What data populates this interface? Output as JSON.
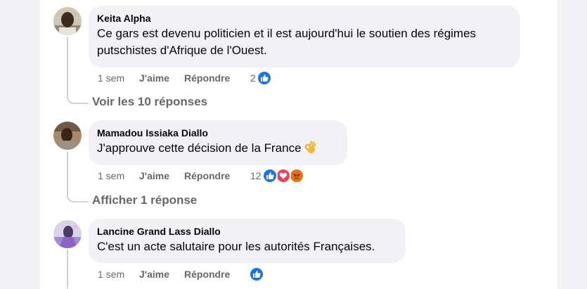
{
  "comments": [
    {
      "author": "Keita Alpha",
      "text": "Ce gars est devenu politicien et il est aujourd'hui le soutien des régimes putschistes d'Afrique de l'Ouest.",
      "time": "1 sem",
      "like_label": "J'aime",
      "reply_label": "Répondre",
      "reaction_count": "2",
      "reactions": [
        "like-icon"
      ]
    },
    {
      "author": "Mamadou Issiaka Diallo",
      "text": "J'approuve cette décision de la France",
      "emoji": "ok-hand-icon",
      "time": "1 sem",
      "like_label": "J'aime",
      "reply_label": "Répondre",
      "reaction_count": "12",
      "reactions": [
        "like-icon",
        "love-icon",
        "angry-icon"
      ]
    },
    {
      "author": "Lancine Grand Lass Diallo",
      "text": "C'est un acte salutaire pour les autorités Françaises.",
      "time": "1 sem",
      "like_label": "J'aime",
      "reply_label": "Répondre",
      "reaction_count": "",
      "reactions": [
        "like-icon"
      ]
    }
  ],
  "view_replies": [
    "Voir les 10 réponses",
    "Afficher 1 réponse"
  ],
  "colors": {
    "like_blue": "#1b74e4",
    "love_red": "#f33e58",
    "angry_orange": "#e9710f",
    "bubble_bg": "#f0f2f5",
    "secondary_text": "#65676b"
  }
}
